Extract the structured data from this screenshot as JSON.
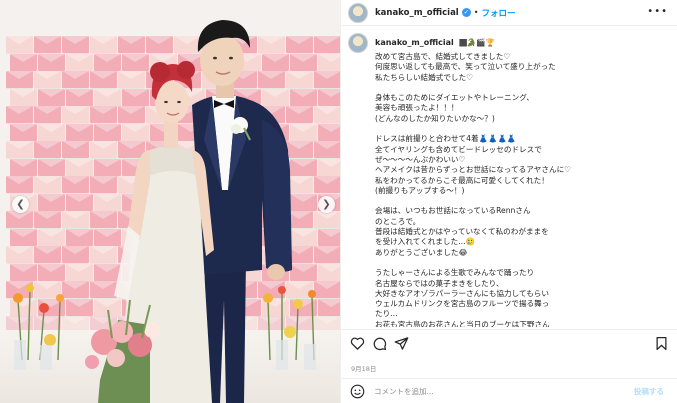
{
  "post": {
    "username": "kanako_m_official",
    "separator": "•",
    "follow_label": "フォロー",
    "more_label": "•••",
    "name_emojis": "🏿🐊🎬🏆",
    "caption": "改めて宮古島で、結婚式してきました♡\n何度思い返しても最高で、笑って泣いて盛り上がった\n私たちらしい結婚式でした♡\n\n身体もこのためにダイエットやトレーニング、\n美容も頑張ったよ！！！\n(どんなのしたか知りたいかな～？)\n\nドレスは前撮りと合わせて4着👗👗👗👗\n全てイヤリングも含めてビードレッセのドレスで\nぜ〜〜〜〜んぶかわいい♡\nヘアメイクは昔からずっとお世話になってるアヤさんに♡\n私をわかってるからこそ最高に可愛くしてくれた！\n(前撮りもアップする～！)\n\n会場は、いつもお世話になっているRennさん\nのところで。\n普段は結婚式とかはやっていなくて私のわがままを\nを受け入れてくれました…🥲\nありがとうございました😂\n\nうたしゃーさんによる生歌でみんなで踊ったり\n名古屋ならではの菓子まきをしたり、\n大好きなアオゾラパーラーさんにも協力してもらい\nウェルカムドリンクを宮古島のフルーツで揚る舞っ\nたり…\nお花も宮古島のお花さんと当日のブーケは下野さん\n特製のブーケ🌻\nオリオンビールで乾杯して体に優しい軽食を🍽",
    "date": "9月18日",
    "comment_placeholder": "コメントを追加...",
    "post_button": "投稿する"
  },
  "icons": {
    "avatar": "profile-avatar",
    "verified": "verified-badge-icon",
    "like": "heart-icon",
    "comment": "comment-icon",
    "share": "paper-plane-icon",
    "save": "bookmark-icon",
    "emoji": "smiley-icon",
    "prev": "chevron-left-icon",
    "next": "chevron-right-icon"
  },
  "colors": {
    "accent": "#0095f6",
    "verified": "#3897f0",
    "envelope_pink": "#f2aab5",
    "envelope_pale": "#f7d6d2",
    "suit_navy": "#1e2a4d"
  }
}
